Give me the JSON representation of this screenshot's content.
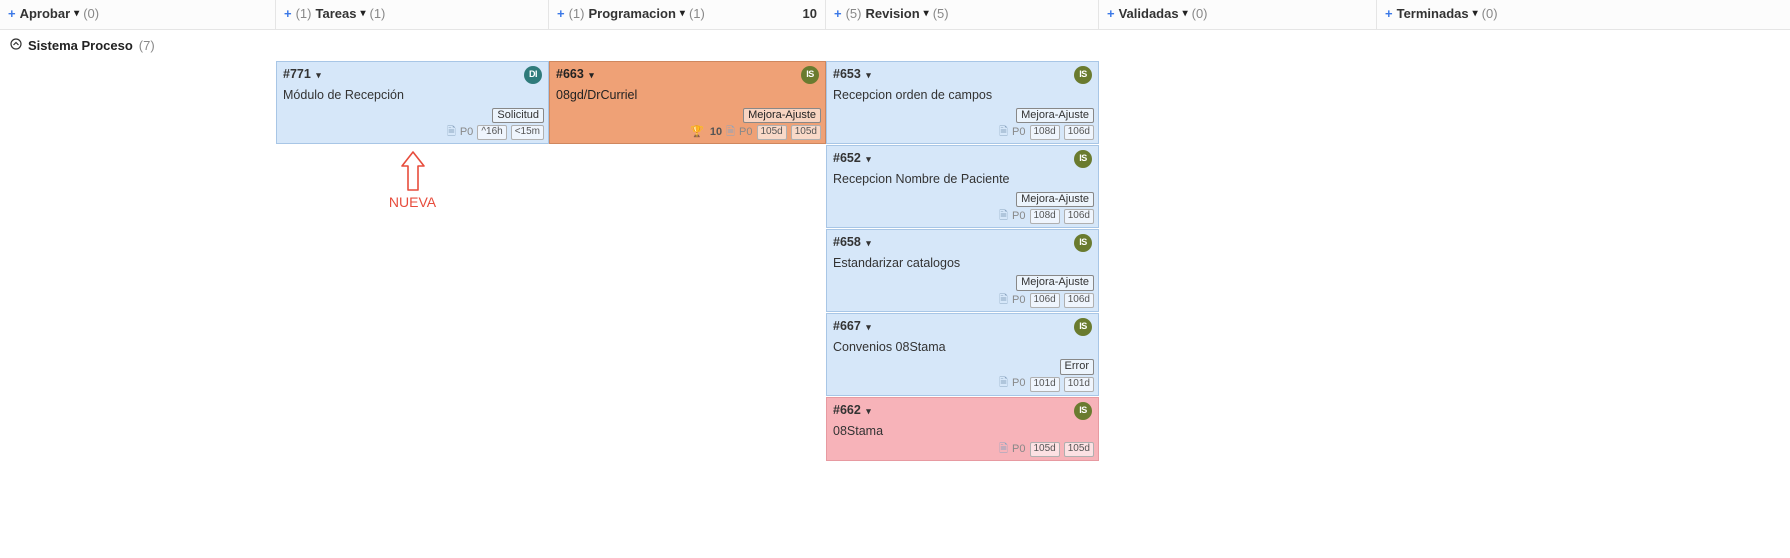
{
  "columns": [
    {
      "name": "Aprobar",
      "left_count": null,
      "right_count": "(0)",
      "limit": null
    },
    {
      "name": "Tareas",
      "left_count": "(1)",
      "right_count": "(1)",
      "limit": null
    },
    {
      "name": "Programacion",
      "left_count": "(1)",
      "right_count": "(1)",
      "limit": "10"
    },
    {
      "name": "Revision",
      "left_count": "(5)",
      "right_count": "(5)",
      "limit": null
    },
    {
      "name": "Validadas",
      "left_count": null,
      "right_count": "(0)",
      "limit": null
    },
    {
      "name": "Terminadas",
      "left_count": null,
      "right_count": "(0)",
      "limit": null
    }
  ],
  "swimlane": {
    "name": "Sistema Proceso",
    "count": "(7)"
  },
  "cards": {
    "tareas": [
      {
        "id": "#771",
        "title": "Módulo de Recepción",
        "tag": "Solicitud",
        "avatar": "DI",
        "priority": "P0",
        "time1": "^16h",
        "time2": "<15m",
        "score": null
      }
    ],
    "programacion": [
      {
        "id": "#663",
        "title": "08gd/DrCurriel",
        "tag": "Mejora-Ajuste",
        "avatar": "IS",
        "priority": "P0",
        "time1": "105d",
        "time2": "105d",
        "score": "10"
      }
    ],
    "revision": [
      {
        "id": "#653",
        "title": "Recepcion orden de campos",
        "tag": "Mejora-Ajuste",
        "avatar": "IS",
        "priority": "P0",
        "time1": "108d",
        "time2": "106d"
      },
      {
        "id": "#652",
        "title": "Recepcion Nombre de Paciente",
        "tag": "Mejora-Ajuste",
        "avatar": "IS",
        "priority": "P0",
        "time1": "108d",
        "time2": "106d"
      },
      {
        "id": "#658",
        "title": "Estandarizar catalogos",
        "tag": "Mejora-Ajuste",
        "avatar": "IS",
        "priority": "P0",
        "time1": "106d",
        "time2": "106d"
      },
      {
        "id": "#667",
        "title": "Convenios 08Stama",
        "tag": "Error",
        "avatar": "IS",
        "priority": "P0",
        "time1": "101d",
        "time2": "101d"
      },
      {
        "id": "#662",
        "title": "08Stama",
        "tag": null,
        "avatar": "IS",
        "priority": "P0",
        "time1": "105d",
        "time2": "105d"
      }
    ]
  },
  "annotation": {
    "label": "NUEVA"
  },
  "glyph": {
    "plus": "+",
    "caret": "▾",
    "chev_up": "◔",
    "doc": "🗎",
    "trophy": "🏆"
  }
}
